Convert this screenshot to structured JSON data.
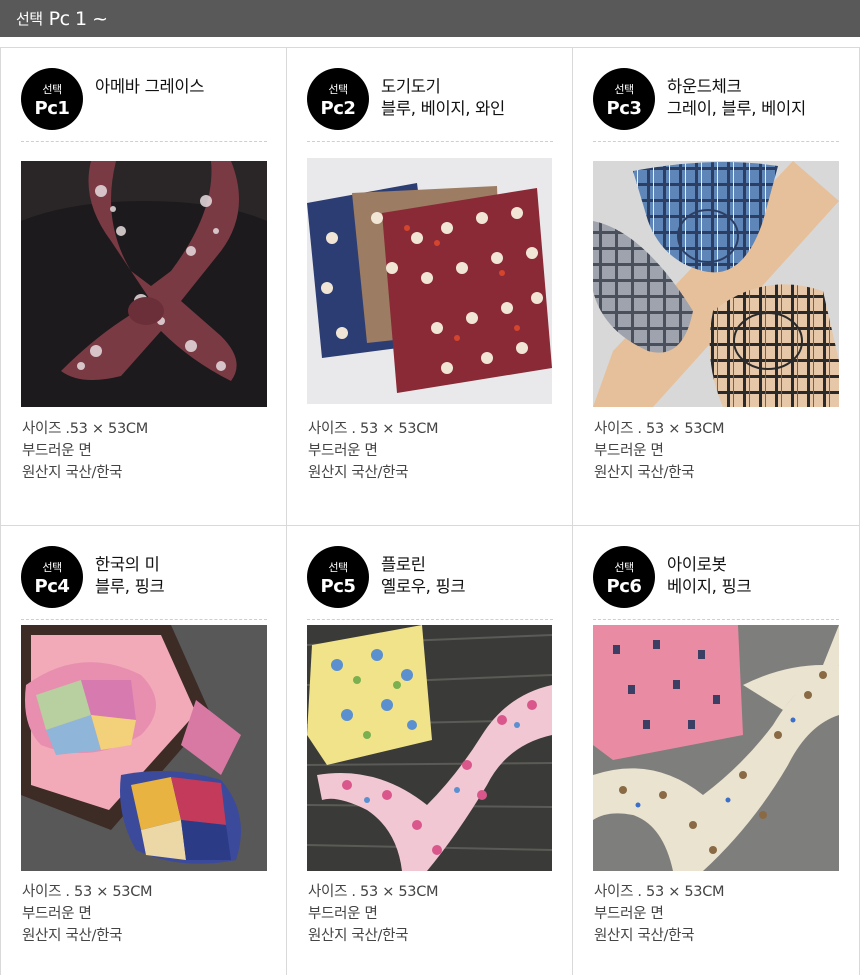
{
  "header": {
    "prefix": "선택",
    "title": "Pc 1 ~"
  },
  "products": [
    {
      "badge_top": "선택",
      "badge_code": "Pc1",
      "name_lines": [
        "아메바 그레이스",
        ""
      ],
      "photo_icon": "paisley-scarf-photo",
      "specs": [
        "사이즈 .53 × 53CM",
        "부드러운 면",
        "원산지 국산/한국"
      ]
    },
    {
      "badge_top": "선택",
      "badge_code": "Pc2",
      "name_lines": [
        "도기도기",
        "블루, 베이지, 와인"
      ],
      "photo_icon": "dog-print-scarf-photo",
      "specs": [
        "사이즈 . 53 × 53CM",
        "부드러운 면",
        "원산지 국산/한국"
      ]
    },
    {
      "badge_top": "선택",
      "badge_code": "Pc3",
      "name_lines": [
        "하운드체크",
        "그레이, 블루, 베이지"
      ],
      "photo_icon": "check-scarf-photo",
      "specs": [
        "사이즈 . 53 × 53CM",
        "부드러운 면",
        "원산지 국산/한국"
      ]
    },
    {
      "badge_top": "선택",
      "badge_code": "Pc4",
      "name_lines": [
        "한국의 미",
        "블루, 핑크"
      ],
      "photo_icon": "patchwork-scarf-photo",
      "specs": [
        "사이즈 . 53 × 53CM",
        "부드러운 면",
        "원산지 국산/한국"
      ]
    },
    {
      "badge_top": "선택",
      "badge_code": "Pc5",
      "name_lines": [
        "플로린",
        "옐로우, 핑크"
      ],
      "photo_icon": "floral-scarf-photo",
      "specs": [
        "사이즈 . 53 × 53CM",
        "부드러운 면",
        "원산지 국산/한국"
      ]
    },
    {
      "badge_top": "선택",
      "badge_code": "Pc6",
      "name_lines": [
        "아이로봇",
        "베이지, 핑크"
      ],
      "photo_icon": "robot-print-scarf-photo",
      "specs": [
        "사이즈 . 53 × 53CM",
        "부드러운 면",
        "원산지 국산/한국"
      ]
    }
  ],
  "colors": {
    "header_bg": "#595959",
    "badge_bg": "#000000",
    "border": "#d9d9d9"
  }
}
